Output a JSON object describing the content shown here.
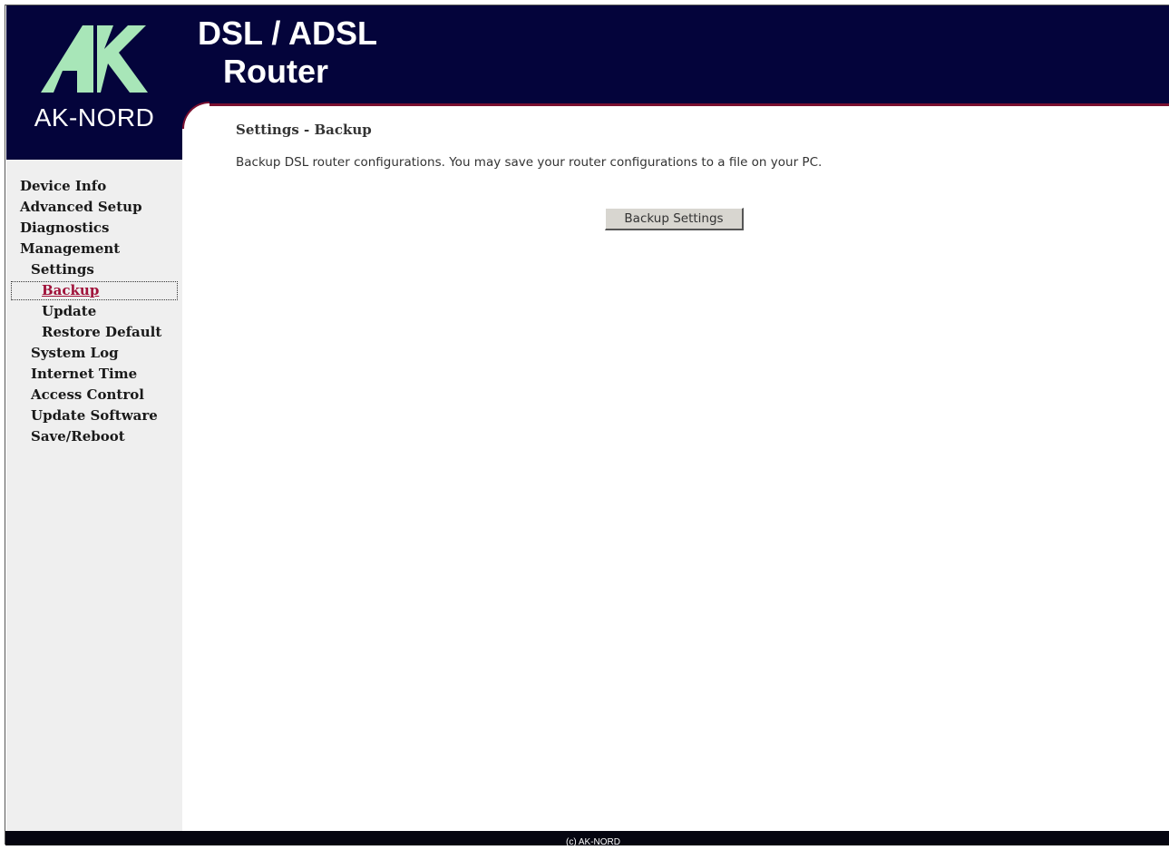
{
  "logo": {
    "brand": "AK-NORD",
    "icon": "ak-logo-icon",
    "color": "#a8e6b8"
  },
  "banner": {
    "title_line1": "DSL / ADSL",
    "title_line2": "Router"
  },
  "colors": {
    "header_bg": "#04043b",
    "accent": "#7a1030",
    "nav_active": "#a0123a",
    "sidebar_bg": "#efefef"
  },
  "nav": {
    "items": [
      {
        "label": "Device Info"
      },
      {
        "label": "Advanced Setup"
      },
      {
        "label": "Diagnostics"
      },
      {
        "label": "Management"
      },
      {
        "label": "Settings"
      },
      {
        "label": "Backup"
      },
      {
        "label": "Update"
      },
      {
        "label": "Restore Default"
      },
      {
        "label": "System Log"
      },
      {
        "label": "Internet Time"
      },
      {
        "label": "Access Control"
      },
      {
        "label": "Update Software"
      },
      {
        "label": "Save/Reboot"
      }
    ]
  },
  "main": {
    "title": "Settings - Backup",
    "description": "Backup DSL router configurations. You may save your router configurations to a file on your PC.",
    "button_label": "Backup Settings"
  },
  "footer": {
    "text": "(c) AK-NORD"
  }
}
